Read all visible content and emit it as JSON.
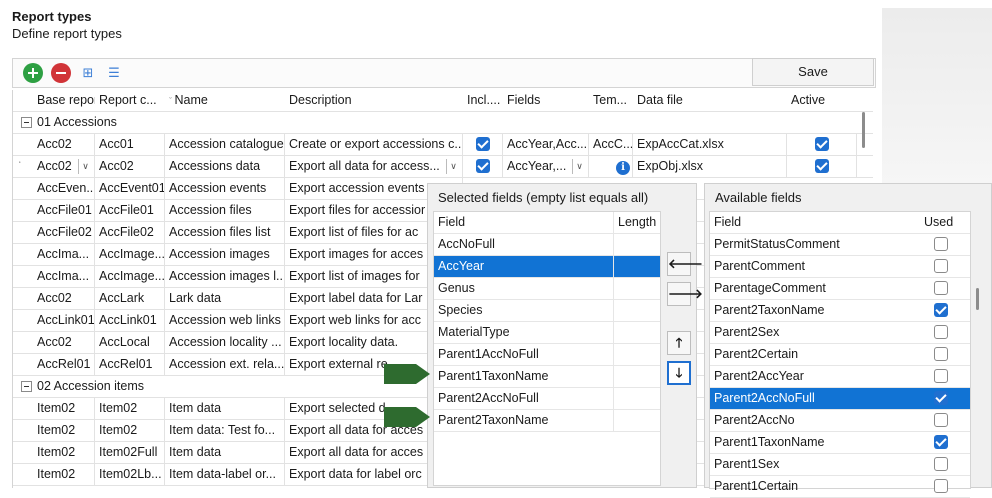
{
  "header": {
    "title": "Report types",
    "subtitle": "Define report types"
  },
  "toolbar": {
    "icons": [
      "add-icon",
      "remove-icon",
      "expand-tree-icon",
      "collapse-tree-icon"
    ],
    "save_label": "Save"
  },
  "grid": {
    "columns": [
      "Base report",
      "Report c...",
      "Name",
      "Description",
      "Incl....",
      "Fields",
      "Tem...",
      "Data file",
      "Active"
    ],
    "groups": [
      "01 Accessions",
      "02 Accession items"
    ],
    "rows": [
      {
        "base": "Acc02",
        "code": "Acc01",
        "name": "Accession catalogue",
        "desc": "Create or export accessions c...",
        "incl": true,
        "fields": "AccYear,Acc...",
        "tem": "AccC...",
        "file": "ExpAccCat.xlsx",
        "active": true
      },
      {
        "base": "Acc02",
        "code": "Acc02",
        "name": "Accessions data",
        "desc": "Export all data for access...",
        "incl": true,
        "fields": "AccYear,...",
        "tem": "",
        "file": "ExpObj.xlsx",
        "active": true
      },
      {
        "base": "AccEven...",
        "code": "AccEvent01",
        "name": "Accession events",
        "desc": "Export accession events"
      },
      {
        "base": "AccFile01",
        "code": "AccFile01",
        "name": "Accession files",
        "desc": "Export files for accessior"
      },
      {
        "base": "AccFile02",
        "code": "AccFile02",
        "name": "Accession files list",
        "desc": "Export list of files for ac"
      },
      {
        "base": "AccIma...",
        "code": "AccImage...",
        "name": "Accession images",
        "desc": "Export images for acces"
      },
      {
        "base": "AccIma...",
        "code": "AccImage...",
        "name": "Accession images l...",
        "desc": "Export list of images for"
      },
      {
        "base": "Acc02",
        "code": "AccLark",
        "name": "Lark data",
        "desc": "Export label data for Lar"
      },
      {
        "base": "AccLink01",
        "code": "AccLink01",
        "name": "Accession web links",
        "desc": "Export web links for acc"
      },
      {
        "base": "Acc02",
        "code": "AccLocal",
        "name": "Accession locality ...",
        "desc": "Export locality data."
      },
      {
        "base": "AccRel01",
        "code": "AccRel01",
        "name": "Accession ext. rela...",
        "desc": "Export external re"
      },
      {
        "base": "Item02",
        "code": "Item02",
        "name": "Item data",
        "desc": "Export selected d"
      },
      {
        "base": "Item02",
        "code": "Item02",
        "name": "Item data: Test fo...",
        "desc": "Export all data for acces"
      },
      {
        "base": "Item02",
        "code": "Item02Full",
        "name": "Item data",
        "desc": "Export all data for acces"
      },
      {
        "base": "Item02",
        "code": "Item02Lb...",
        "name": "Item data-label or...",
        "desc": "Export data for label orc"
      }
    ]
  },
  "selected_fields": {
    "title": "Selected fields (empty list equals all)",
    "col_field": "Field",
    "col_length": "Length",
    "items": [
      "AccNoFull",
      "AccYear",
      "Genus",
      "Species",
      "MaterialType",
      "Parent1AccNoFull",
      "Parent1TaxonName",
      "Parent2AccNoFull",
      "Parent2TaxonName"
    ],
    "selected_index": 1
  },
  "move_buttons": {
    "add": "🡐",
    "remove": "🡒",
    "up": "🡑",
    "down": "🡓"
  },
  "available_fields": {
    "title": "Available fields",
    "col_field": "Field",
    "col_used": "Used",
    "items": [
      {
        "name": "PermitStatusComment",
        "used": false
      },
      {
        "name": "ParentComment",
        "used": false
      },
      {
        "name": "ParentageComment",
        "used": false
      },
      {
        "name": "Parent2TaxonName",
        "used": true
      },
      {
        "name": "Parent2Sex",
        "used": false
      },
      {
        "name": "Parent2Certain",
        "used": false
      },
      {
        "name": "Parent2AccYear",
        "used": false
      },
      {
        "name": "Parent2AccNoFull",
        "used": true
      },
      {
        "name": "Parent2AccNo",
        "used": false
      },
      {
        "name": "Parent1TaxonName",
        "used": true
      },
      {
        "name": "Parent1Sex",
        "used": false
      },
      {
        "name": "Parent1Certain",
        "used": false
      }
    ],
    "selected_index": 7
  },
  "colors": {
    "accent": "#1173d4",
    "annotation_arrow": "#2e6b2f"
  }
}
